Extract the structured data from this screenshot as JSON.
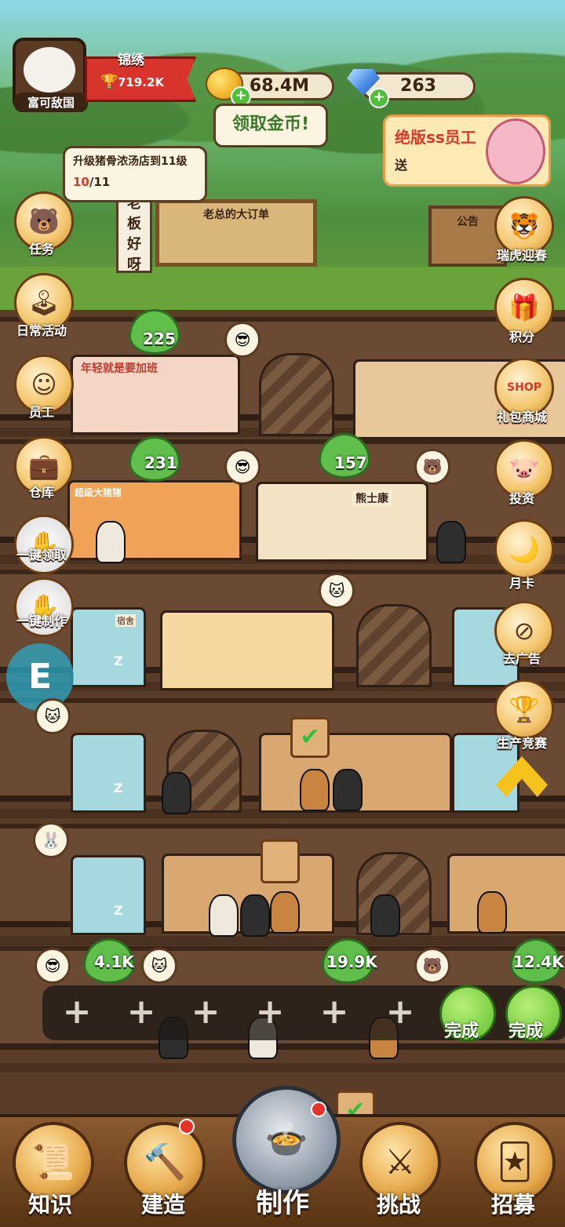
{
  "player": {
    "name": "富可敌国",
    "title": "锦绣",
    "trophy_value": "719.2K"
  },
  "currency": {
    "coins": "68.4M",
    "gems": "263",
    "claim_coins_label": "领取金币!"
  },
  "promo": {
    "title": "绝版ss员工",
    "sub": "送"
  },
  "task_tip": {
    "text": "升级猪骨浓汤店到11级",
    "progress_current": "10",
    "progress_total": "/11"
  },
  "scene": {
    "board_title": "老总的大订单",
    "vertical_sign": [
      "老",
      "板",
      "好",
      "呀"
    ],
    "notice": "公告"
  },
  "left_menu": [
    {
      "label": "任务",
      "icon": "mission-icon"
    },
    {
      "label": "日常活动",
      "icon": "arcade-icon"
    },
    {
      "label": "员工",
      "icon": "staff-icon"
    },
    {
      "label": "仓库",
      "icon": "warehouse-icon"
    },
    {
      "label": "一键领取",
      "icon": "collect-all-icon"
    },
    {
      "label": "一键制作",
      "icon": "craft-all-icon"
    }
  ],
  "right_menu": [
    {
      "label": "瑞虎迎春",
      "icon": "tiger-icon"
    },
    {
      "label": "积分",
      "icon": "gift-box-icon"
    },
    {
      "label": "礼包商城",
      "icon": "shop-icon"
    },
    {
      "label": "投资",
      "icon": "piggy-bank-icon"
    },
    {
      "label": "月卡",
      "icon": "month-card-icon"
    },
    {
      "label": "去广告",
      "icon": "no-ads-icon"
    },
    {
      "label": "生产竞赛",
      "icon": "contest-icon"
    }
  ],
  "bubbles": {
    "b225": "225",
    "b231": "231",
    "b157": "157",
    "b41k": "4.1K",
    "b199k": "19.9K",
    "b124k": "12.4K"
  },
  "shop_signs": {
    "s1": "年轻就是要加班",
    "s2": "超级大猪猪",
    "s3": "熊士康",
    "dorm": "宿舍"
  },
  "queue": {
    "done_label": "完成"
  },
  "bottom_nav": [
    {
      "label": "知识",
      "icon": "scroll-icon"
    },
    {
      "label": "建造",
      "icon": "hammer-icon"
    },
    {
      "label": "制作",
      "icon": "cooking-pot-icon"
    },
    {
      "label": "挑战",
      "icon": "swords-icon"
    },
    {
      "label": "招募",
      "icon": "cards-icon"
    }
  ],
  "colors": {
    "accent_green": "#5fbf4a",
    "banner_red": "#d8332c",
    "wood": "#6b4a33"
  }
}
